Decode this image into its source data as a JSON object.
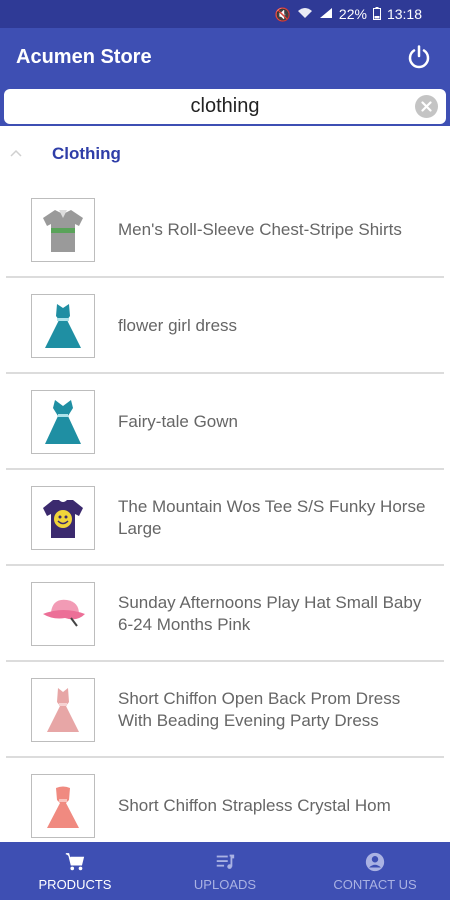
{
  "status_bar": {
    "battery": "22%",
    "time": "13:18"
  },
  "app_bar": {
    "title": "Acumen Store",
    "power_icon": "power-icon"
  },
  "search": {
    "value": "clothing"
  },
  "section": {
    "title": "Clothing"
  },
  "products": [
    {
      "name": "Men's Roll-Sleeve Chest-Stripe Shirts",
      "icon": "shirt"
    },
    {
      "name": "flower girl dress",
      "icon": "dress-teal"
    },
    {
      "name": "Fairy-tale Gown",
      "icon": "dress-teal"
    },
    {
      "name": "The Mountain Wos Tee S/S Funky Horse Large",
      "icon": "tshirt-purple"
    },
    {
      "name": "Sunday Afternoons Play Hat Small Baby 6-24 Months Pink",
      "icon": "hat-pink"
    },
    {
      "name": "Short Chiffon Open Back Prom Dress With Beading Evening Party Dress",
      "icon": "dress-pink"
    },
    {
      "name": "Short Chiffon Strapless Crystal Hom",
      "icon": "dress-coral"
    }
  ],
  "bottom_nav": {
    "products": "PRODUCTS",
    "uploads": "UPLOADS",
    "contact": "CONTACT US"
  },
  "colors": {
    "primary": "#3e4fb3",
    "status": "#2f3a96",
    "accent_text": "#2f3ea8"
  }
}
